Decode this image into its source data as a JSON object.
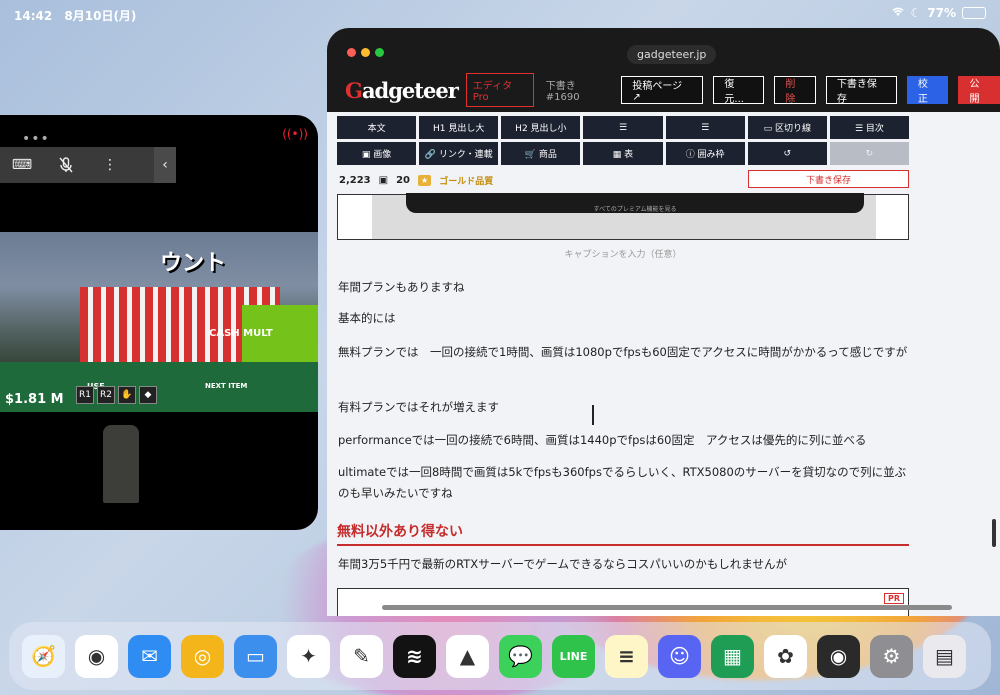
{
  "status_bar": {
    "time": "14:42",
    "date": "8月10日(月)",
    "battery": "77%",
    "battery_level": 0.77
  },
  "game_window": {
    "dots": "•••",
    "toolbar": {
      "keyboard": "⌨",
      "mic": "🎙",
      "more": "⋮",
      "collapse": "‹"
    },
    "cash_text": "CASH MULT",
    "money": "$1.81 M",
    "use_label": "USE",
    "next_label": "NEXT ITEM",
    "sign_text": "ウント"
  },
  "browser": {
    "url": "gadgeteer.jp",
    "logo_prefix": "G",
    "logo_rest": "adgeteer",
    "editor_badge": "エディタPro",
    "draft_number": "下書き #1690",
    "buttons": {
      "post_page": "投稿ページ ↗",
      "restore": "復元...",
      "delete": "削除",
      "save_draft": "下書き保存",
      "proofread": "校正",
      "publish": "公開"
    },
    "tools": [
      {
        "label": "本文"
      },
      {
        "label": "H1 見出し大"
      },
      {
        "label": "H2 見出し小"
      },
      {
        "label": "☰"
      },
      {
        "label": "☰"
      },
      {
        "label": "▭ 区切り線"
      },
      {
        "label": "☰ 目次"
      },
      {
        "label": "▣ 画像"
      },
      {
        "label": "🔗 リンク・連載"
      },
      {
        "label": "🛒 商品"
      },
      {
        "label": "▦ 表"
      },
      {
        "label": "ⓘ 囲み枠"
      },
      {
        "label": "↺"
      },
      {
        "label": "↻"
      }
    ],
    "stats": {
      "word_count": "2,223",
      "image_count": "20",
      "gold_label": "ゴールド品質"
    },
    "draft_save_label": "下書き保存",
    "image_inner_text": "すべてのプレミアム機能を見る",
    "caption": "キャプションを入力（任意）",
    "paragraphs": [
      "年間プランもありますね",
      "基本的には",
      "無料プランでは　一回の接続で1時間、画質は1080pでfpsも60固定でアクセスに時間がかかるって感じですが",
      "有料プランではそれが増えます",
      "performanceでは一回の接続で6時間、画質は1440pでfpsは60固定　アクセスは優先的に列に並べる",
      "ultimateでは一回8時間で画質は5kでfpsも360fpsでるらしいく、RTX5080のサーバーを貸切なので列に並ぶのも早いみたいですね"
    ],
    "heading": "無料以外あり得ない",
    "after_heading": "年間3万5千円で最新のRTXサーバーでゲームできるならコスパいいのかもしれませんが",
    "pr_label": "PR"
  },
  "dock": [
    {
      "name": "safari",
      "glyph": "🧭",
      "color": "#e8f1fb"
    },
    {
      "name": "chrome",
      "glyph": "◉",
      "color": "#ffffff"
    },
    {
      "name": "mail",
      "glyph": "✉",
      "color": "#2f8cf2"
    },
    {
      "name": "spiral",
      "glyph": "◎",
      "color": "#f4b51a"
    },
    {
      "name": "files",
      "glyph": "▭",
      "color": "#3d8fee"
    },
    {
      "name": "gemini",
      "glyph": "✦",
      "color": "#ffffff"
    },
    {
      "name": "writer",
      "glyph": "✎",
      "color": "#ffffff"
    },
    {
      "name": "spotify",
      "glyph": "≋",
      "color": "#121212"
    },
    {
      "name": "drive",
      "glyph": "▲",
      "color": "#ffffff"
    },
    {
      "name": "messages",
      "glyph": "💬",
      "color": "#3bd15a"
    },
    {
      "name": "line",
      "glyph": "LINE",
      "color": "#2fc34b"
    },
    {
      "name": "notes",
      "glyph": "≡",
      "color": "#fff6c8"
    },
    {
      "name": "discord",
      "glyph": "☺",
      "color": "#5865f2"
    },
    {
      "name": "classroom",
      "glyph": "▦",
      "color": "#1f9d55"
    },
    {
      "name": "photos",
      "glyph": "✿",
      "color": "#ffffff"
    },
    {
      "name": "camera",
      "glyph": "◉",
      "color": "#2a2a2a"
    },
    {
      "name": "settings",
      "glyph": "⚙",
      "color": "#8e8e93"
    },
    {
      "name": "folder-apps",
      "glyph": "▤",
      "color": "#e9e9ee"
    }
  ]
}
